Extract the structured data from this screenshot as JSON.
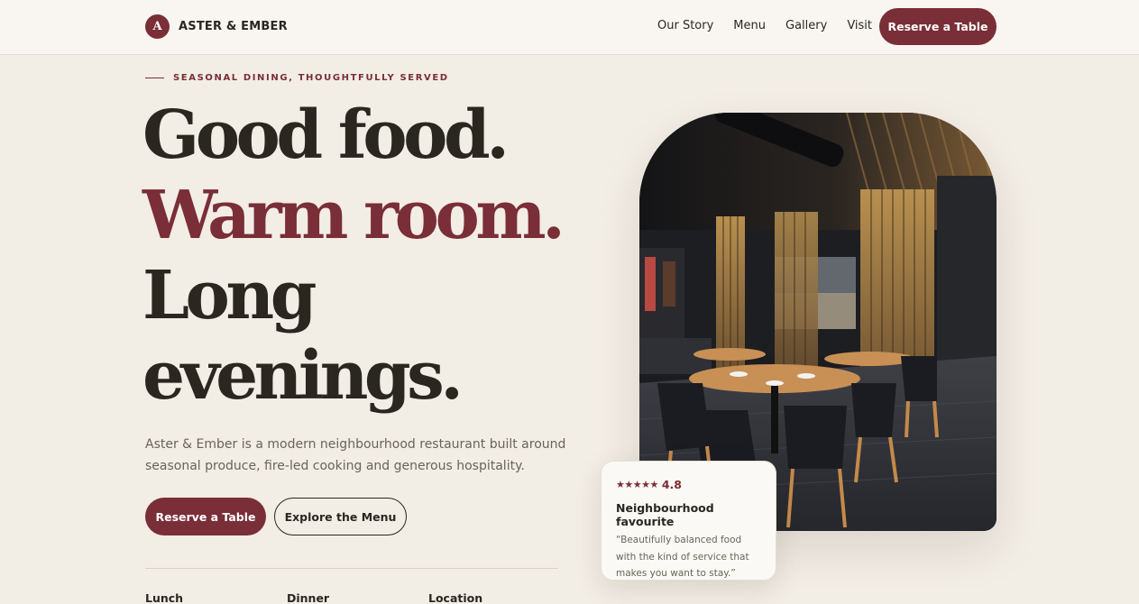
{
  "brand": {
    "mark": "A",
    "name": "ASTER & EMBER",
    "accent_color": "#7a2e37"
  },
  "nav": {
    "items": [
      {
        "label": "Our Story"
      },
      {
        "label": "Menu"
      },
      {
        "label": "Gallery"
      },
      {
        "label": "Visit"
      }
    ],
    "cta_label": "Reserve a Table"
  },
  "hero": {
    "eyebrow": "SEASONAL DINING, THOUGHTFULLY SERVED",
    "headline": {
      "line1": "Good food.",
      "line2": "Warm room.",
      "line3": "Long",
      "line4": "evenings."
    },
    "lede": "Aster & Ember is a modern neighbourhood restaurant built around seasonal produce, fire-led cooking and generous hospitality.",
    "primary_button": "Reserve a Table",
    "secondary_button": "Explore the Menu",
    "info": {
      "lunch_label": "Lunch",
      "dinner_label": "Dinner",
      "location_label": "Location"
    }
  },
  "review": {
    "stars": "★★★★★",
    "rating_value": 5,
    "score": "4.8",
    "title": "Neighbourhood favourite",
    "quote": "“Beautifully balanced food with the kind of service that makes you want to stay.”"
  },
  "photo": {
    "icon": "restaurant-interior-photo"
  }
}
